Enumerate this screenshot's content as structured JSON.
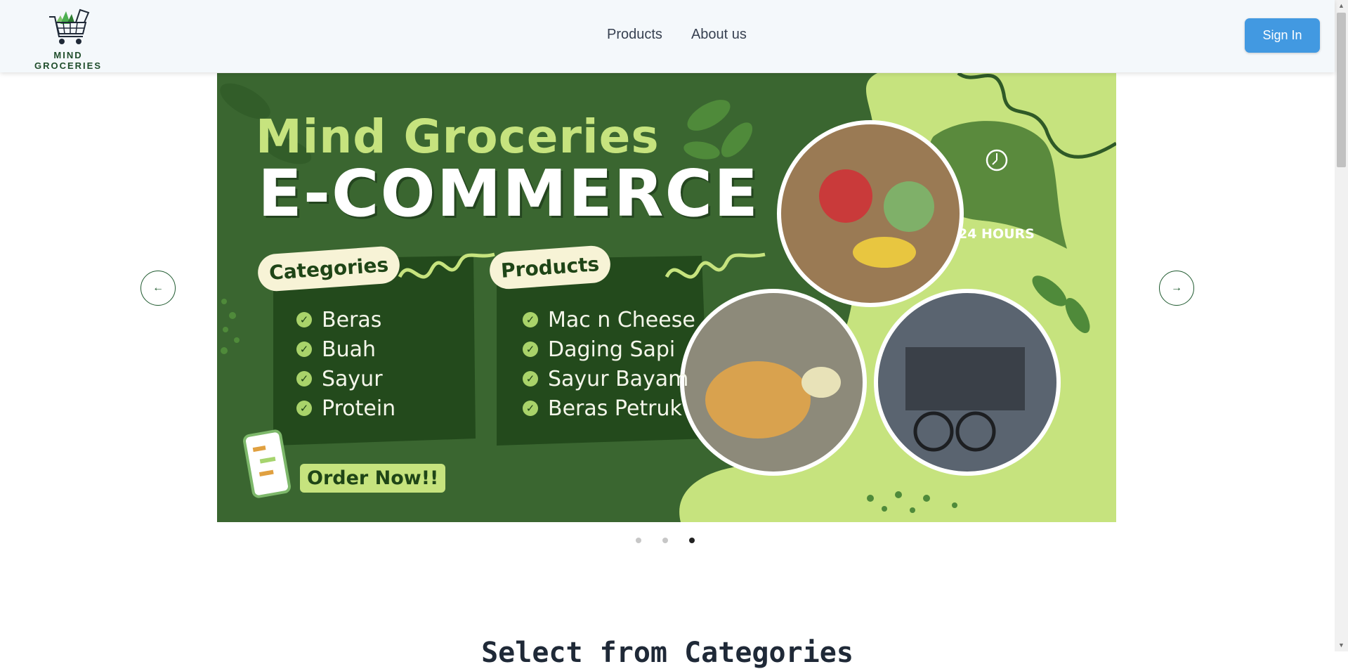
{
  "brand": {
    "name": "MIND GROCERIES"
  },
  "nav": {
    "items": [
      "Products",
      "About us"
    ]
  },
  "header": {
    "signin_label": "Sign In"
  },
  "banner": {
    "title_line1": "Mind Groceries",
    "title_line2": "E-COMMERCE",
    "categories_label": "Categories",
    "categories": [
      "Beras",
      "Buah",
      "Sayur",
      "Protein"
    ],
    "products_label": "Products",
    "products": [
      "Mac n Cheese",
      "Daging Sapi",
      "Sayur Bayam",
      "Beras Petruk"
    ],
    "order_label": "Order Now!!",
    "hours_label": "24 HOURS"
  },
  "carousel": {
    "slide_count": 3,
    "active_index": 2
  },
  "section": {
    "title": "Select from Categories"
  },
  "colors": {
    "accent": "#4299e1",
    "banner_green": "#3a6630",
    "light_green": "#c6e37e"
  }
}
